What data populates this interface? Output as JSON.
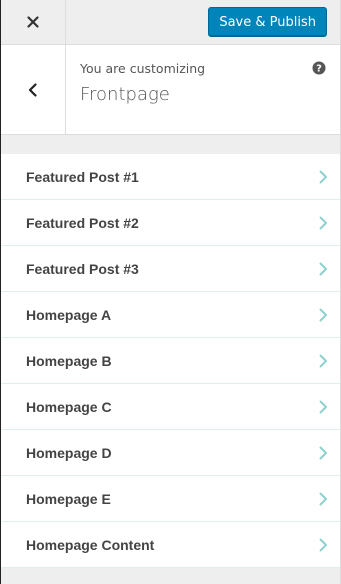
{
  "header": {
    "close_label": "Close",
    "publish_label": "Save & Publish"
  },
  "panel": {
    "subtitle": "You are customizing",
    "title": "Frontpage"
  },
  "sections": [
    {
      "label": "Featured Post #1"
    },
    {
      "label": "Featured Post #2"
    },
    {
      "label": "Featured Post #3"
    },
    {
      "label": "Homepage A"
    },
    {
      "label": "Homepage B"
    },
    {
      "label": "Homepage C"
    },
    {
      "label": "Homepage D"
    },
    {
      "label": "Homepage E"
    },
    {
      "label": "Homepage Content"
    }
  ],
  "colors": {
    "accent": "#0085ba",
    "chevron": "#8ed1cc",
    "background": "#eeeeee"
  },
  "icons": {
    "close": "close-icon",
    "back": "chevron-left-icon",
    "help": "help-icon",
    "section_arrow": "chevron-right-icon"
  }
}
